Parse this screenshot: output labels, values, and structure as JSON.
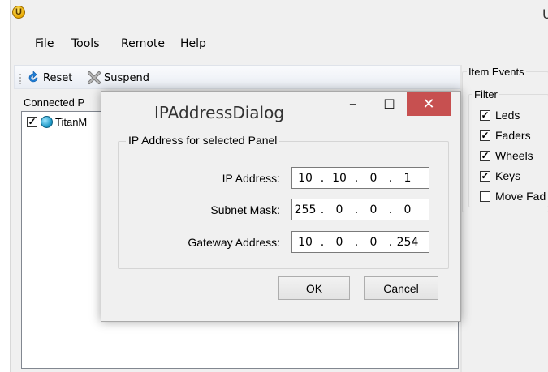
{
  "app": {
    "logo_letter": "U",
    "title_fragment": "U"
  },
  "menu": {
    "items": [
      {
        "label": "File"
      },
      {
        "label": "Tools"
      },
      {
        "label": "Remote"
      },
      {
        "label": "Help"
      }
    ]
  },
  "toolbar": {
    "reset_label": "Reset",
    "reset_icon": "refresh-icon",
    "suspend_label": "Suspend",
    "suspend_icon": "x-icon"
  },
  "connected_panels": {
    "label": "Connected P",
    "items": [
      {
        "label": "TitanM",
        "checked": true,
        "icon": "globe-icon"
      }
    ]
  },
  "item_events": {
    "label": "Item Events",
    "filter_label": "Filter",
    "filters": [
      {
        "label": "Leds",
        "checked": true
      },
      {
        "label": "Faders",
        "checked": true
      },
      {
        "label": "Wheels",
        "checked": true
      },
      {
        "label": "Keys",
        "checked": true
      },
      {
        "label": "Move Fad",
        "checked": false
      }
    ]
  },
  "dialog": {
    "title": "IPAddressDialog",
    "minimize_glyph": "–",
    "maximize_glyph": "☐",
    "close_glyph": "✕",
    "group_label": "IP Address for selected Panel",
    "fields": [
      {
        "label": "IP Address:",
        "octets": [
          "10",
          "10",
          "0",
          "1"
        ]
      },
      {
        "label": "Subnet Mask:",
        "octets": [
          "255",
          "0",
          "0",
          "0"
        ]
      },
      {
        "label": "Gateway Address:",
        "octets": [
          "10",
          "0",
          "0",
          "254"
        ]
      }
    ],
    "ok_label": "OK",
    "cancel_label": "Cancel"
  },
  "colors": {
    "close_button": "#c75050",
    "window_bg": "#f0f0f0"
  }
}
